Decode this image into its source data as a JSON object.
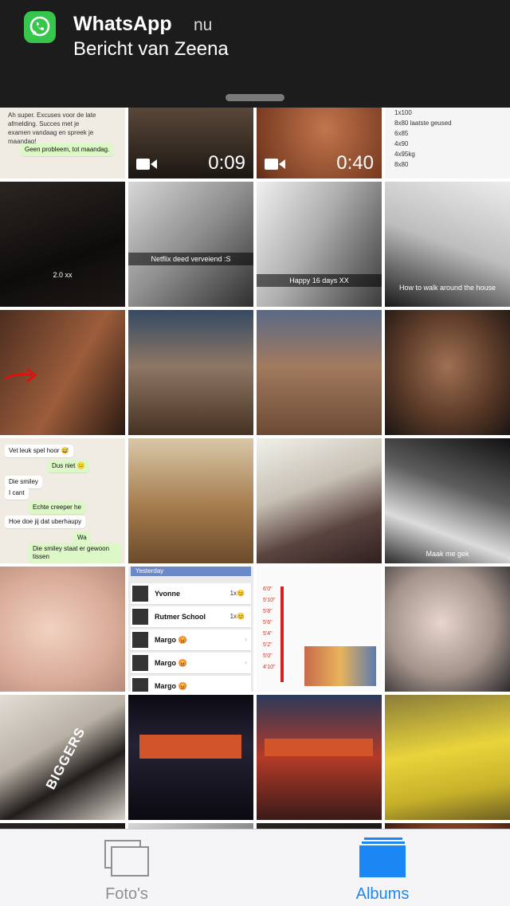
{
  "notification": {
    "app_name": "WhatsApp",
    "time": "nu",
    "message": "Bericht van Zeena",
    "icon": "whatsapp-icon"
  },
  "grid": {
    "row1": {
      "chat_lines": [
        "Ah super. Excuses voor de late",
        "afmelding. Succes met je",
        "examen vandaag en spreek je",
        "maandag!"
      ],
      "chat_reply": "Geen probleem, tot maandag.",
      "video1_duration": "0:09",
      "video2_duration": "0:40",
      "notes": [
        "1x100",
        "8x80 laatste geused",
        "6x85",
        "4x90",
        "4x95kg",
        "8x80"
      ]
    },
    "row2": {
      "cap1": "2.0 xx",
      "cap2": "Netflix deed verveiend :S",
      "cap3": "Happy 16 days XX",
      "cap4": "How to walk around the house"
    },
    "row4": {
      "chat": [
        {
          "text": "Vet leuk spel hoor 😅",
          "dir": "in"
        },
        {
          "text": "Dus niet 😑",
          "dir": "out"
        },
        {
          "text": "Die smiley",
          "dir": "in"
        },
        {
          "text": "I cant",
          "dir": "in"
        },
        {
          "text": "Echte creeper he",
          "dir": "out"
        },
        {
          "text": "Hoe doe jij dat uberhaupy",
          "dir": "in"
        },
        {
          "text": "Wa",
          "dir": "out"
        },
        {
          "text": "Die smiley staat er gewoon tissen",
          "dir": "out"
        }
      ],
      "cap4": "Maak me gek"
    },
    "row5": {
      "list_header": "Yesterday",
      "contacts": [
        {
          "name": "Yvonne",
          "badge": "1x😊"
        },
        {
          "name": "Rutmer School",
          "badge": "1x😊"
        },
        {
          "name": "Margo 😡",
          "badge": ""
        },
        {
          "name": "Margo 😡",
          "badge": ""
        },
        {
          "name": "Margo 😡",
          "badge": ""
        }
      ],
      "chart_heights": [
        "6'0\"",
        "5'10\"",
        "5'8\"",
        "5'6\"",
        "5'4\"",
        "5'2\"",
        "5'0\"",
        "4'10\""
      ]
    },
    "row6": {
      "shirt_text": "BIGGERS"
    }
  },
  "tabbar": {
    "photos_label": "Foto's",
    "albums_label": "Albums",
    "active": "albums",
    "active_color": "#1b87f5",
    "inactive_color": "#8e8e93"
  }
}
